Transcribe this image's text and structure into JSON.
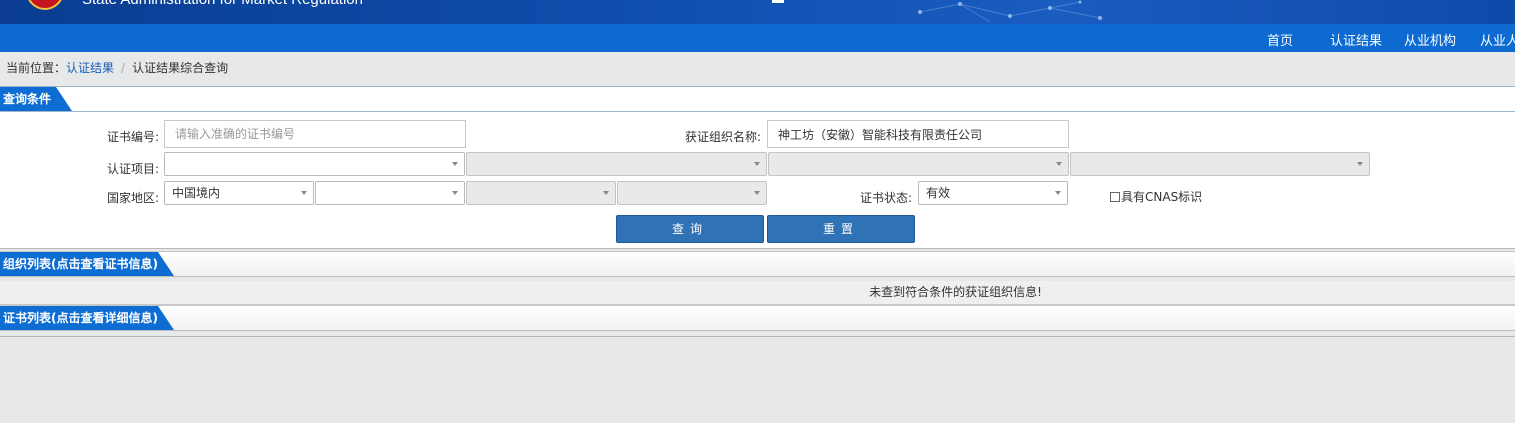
{
  "header": {
    "site_name_en": "State Administration for Market Regulation"
  },
  "nav": {
    "items": [
      "首页",
      "认证结果",
      "从业机构",
      "从业人"
    ]
  },
  "breadcrumb": {
    "prefix": "当前位置：",
    "link": "认证结果",
    "separator": "/",
    "current": "认证结果综合查询"
  },
  "query_section": {
    "title": "查询条件",
    "cert_no_label": "证书编号:",
    "cert_no_placeholder": "请输入准确的证书编号",
    "org_name_label": "获证组织名称:",
    "org_name_value": "神工坊（安徽）智能科技有限责任公司",
    "project_label": "认证项目:",
    "region_label": "国家地区:",
    "region_value": "中国境内",
    "status_label": "证书状态:",
    "status_value": "有效",
    "cnas_label": "具有CNAS标识",
    "search_button": "查询",
    "reset_button": "重置"
  },
  "org_list": {
    "title": "组织列表(点击查看证书信息)",
    "empty_message": "未查到符合条件的获证组织信息!"
  },
  "cert_list": {
    "title": "证书列表(点击查看详细信息)"
  },
  "colors": {
    "nav_blue": "#0c6ad1",
    "tab_blue": "#0e6dd2",
    "button_blue": "#2f72b5"
  }
}
